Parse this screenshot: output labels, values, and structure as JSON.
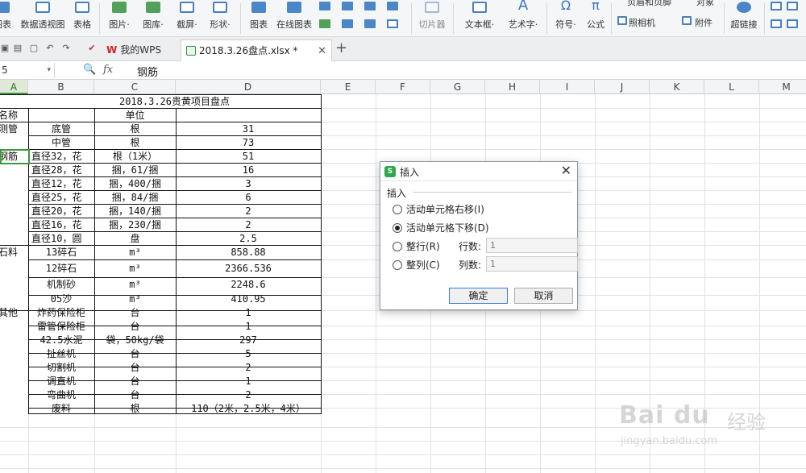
{
  "ribbon": {
    "items": [
      {
        "label": "图表",
        "icon": "chart-icon"
      },
      {
        "label": "数据透视图",
        "icon": "pivot-chart-icon"
      },
      {
        "label": "表格",
        "icon": "table-icon"
      },
      {
        "label": "图片·",
        "icon": "picture-icon"
      },
      {
        "label": "图库·",
        "icon": "gallery-icon"
      },
      {
        "label": "截屏·",
        "icon": "screenshot-icon"
      },
      {
        "label": "形状·",
        "icon": "shape-icon"
      },
      {
        "label": "图表",
        "icon": "chart2-icon"
      },
      {
        "label": "在线图表",
        "icon": "online-chart-icon"
      },
      {
        "label": "切片器",
        "icon": "slicer-icon"
      },
      {
        "label": "文本框·",
        "icon": "textbox-icon"
      },
      {
        "label": "艺术字·",
        "icon": "wordart-icon"
      },
      {
        "label": "符号·",
        "icon": "symbol-icon"
      },
      {
        "label": "公式",
        "icon": "formula-icon"
      },
      {
        "label": "照相机",
        "icon": "camera-icon"
      },
      {
        "label": "附件",
        "icon": "attachment-icon"
      },
      {
        "label": "超链接",
        "icon": "hyperlink-icon"
      }
    ],
    "top_labels": {
      "header_footer": "页眉和页脚",
      "object": "对象"
    }
  },
  "tabs": {
    "wps_tab": "我的WPS",
    "file_tab": "2018.3.26盘点.xlsx *"
  },
  "formula_bar": {
    "name_box": "5",
    "fx": "fx",
    "content": "钢筋"
  },
  "columns": [
    "A",
    "B",
    "C",
    "D",
    "E",
    "F",
    "G",
    "H",
    "I",
    "J",
    "K",
    "L",
    "M"
  ],
  "sheet": {
    "title": "2018.3.26贵黄项目盘点",
    "rows": [
      {
        "a": "名称",
        "b": "",
        "c": "单位",
        "d": ""
      },
      {
        "a": "测管",
        "b": "底管",
        "c": "根",
        "d": "31"
      },
      {
        "a": "",
        "b": "中管",
        "c": "根",
        "d": "73"
      },
      {
        "a": "钢筋",
        "b": "直径32，花",
        "c": "根（1米）",
        "d": "51"
      },
      {
        "a": "",
        "b": "直径28，花",
        "c": "捆，61/捆",
        "d": "16"
      },
      {
        "a": "",
        "b": "直径12，花",
        "c": "捆，400/捆",
        "d": "3"
      },
      {
        "a": "",
        "b": "直径25，花",
        "c": "捆，84/捆",
        "d": "6"
      },
      {
        "a": "",
        "b": "直径20，花",
        "c": "捆，140/捆",
        "d": "2"
      },
      {
        "a": "",
        "b": "直径16，花",
        "c": "捆，230/捆",
        "d": "2"
      },
      {
        "a": "",
        "b": "直径10，圆",
        "c": "盘",
        "d": "2.5"
      },
      {
        "a": "石料",
        "b": "13碎石",
        "c": "m³",
        "d": "858.88"
      },
      {
        "a": "",
        "b": "12碎石",
        "c": "m³",
        "d": "2366.536"
      },
      {
        "a": "",
        "b": "机制砂",
        "c": "m³",
        "d": "2248.6"
      },
      {
        "a": "",
        "b": "05沙",
        "c": "m³",
        "d": "410.95"
      },
      {
        "a": "其他",
        "b": "炸药保险柜",
        "c": "台",
        "d": "1"
      },
      {
        "a": "",
        "b": "雷管保险柜",
        "c": "台",
        "d": "1"
      },
      {
        "a": "",
        "b": "42.5水泥",
        "c": "袋，50kg/袋",
        "d": "297"
      },
      {
        "a": "",
        "b": "扯丝机",
        "c": "台",
        "d": "5"
      },
      {
        "a": "",
        "b": "切割机",
        "c": "台",
        "d": "2"
      },
      {
        "a": "",
        "b": "调直机",
        "c": "台",
        "d": "1"
      },
      {
        "a": "",
        "b": "弯曲机",
        "c": "台",
        "d": "2"
      },
      {
        "a": "",
        "b": "废料",
        "c": "根",
        "d": "110（2米，2.5米，4米）"
      }
    ]
  },
  "dialog": {
    "title": "插入",
    "group_label": "插入",
    "options": {
      "shift_right": "活动单元格右移(I)",
      "shift_down": "活动单元格下移(D)",
      "entire_row": "整行(R)",
      "entire_col": "整列(C)"
    },
    "row_count_label": "行数:",
    "row_count_value": "1",
    "col_count_label": "列数:",
    "col_count_value": "1",
    "ok": "确定",
    "cancel": "取消",
    "selected": "shift_down"
  },
  "watermark": {
    "brand": "Bai du",
    "suffix": "经验",
    "url": "jingyan.baidu.com"
  }
}
